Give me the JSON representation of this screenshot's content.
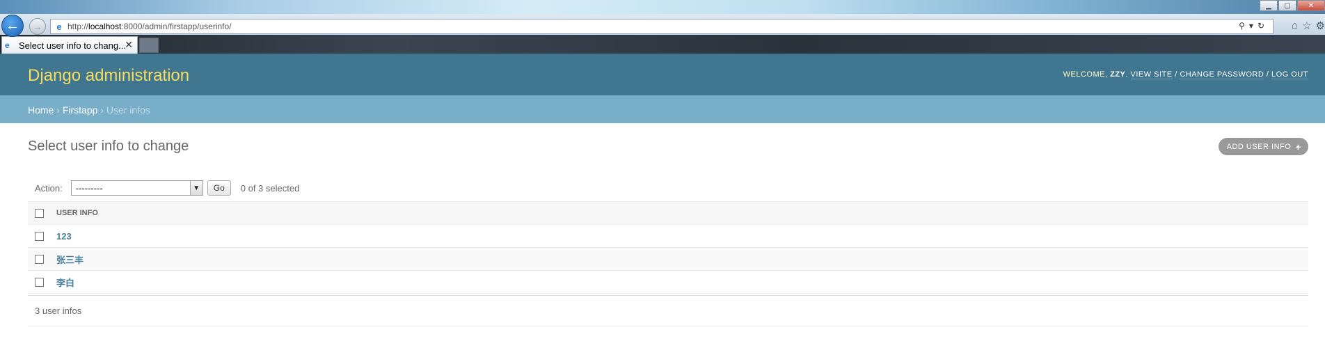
{
  "browser": {
    "address": {
      "scheme": "http://",
      "host": "localhost",
      "path": ":8000/admin/firstapp/userinfo/"
    },
    "tab_title": "Select user info to chang...",
    "tab_close": "✕"
  },
  "header": {
    "branding": "Django administration",
    "welcome": "Welcome,",
    "username": "zzy",
    "view_site": "View site",
    "change_password": "Change password",
    "log_out": "Log out",
    "sep": "/"
  },
  "breadcrumbs": {
    "home": "Home",
    "app": "Firstapp",
    "current": "User infos",
    "sep": "›"
  },
  "main": {
    "title": "Select user info to change",
    "add_button": "Add user info",
    "actions": {
      "label": "Action:",
      "selected": "---------",
      "go": "Go",
      "counter": "0 of 3 selected"
    },
    "table": {
      "column": "User info",
      "rows": [
        "123",
        "张三丰",
        "李白"
      ]
    },
    "paginator": "3 user infos"
  }
}
